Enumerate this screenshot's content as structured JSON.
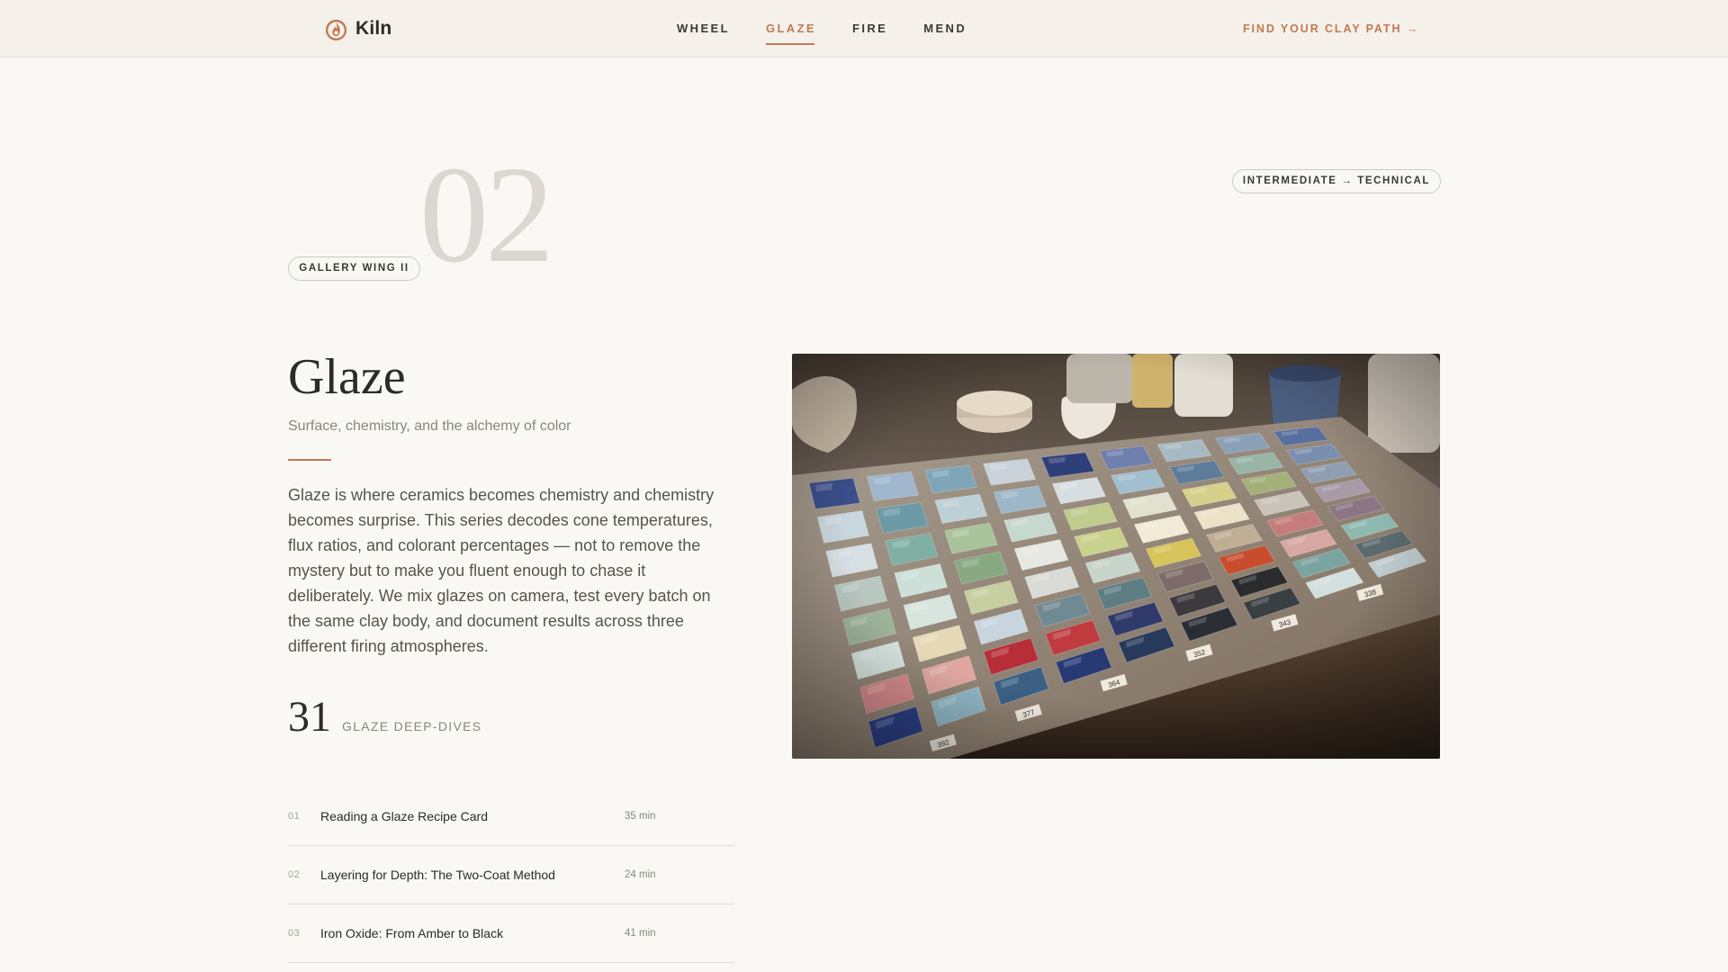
{
  "header": {
    "brand": "Kiln",
    "nav": [
      {
        "label": "WHEEL",
        "active": false
      },
      {
        "label": "GLAZE",
        "active": true
      },
      {
        "label": "FIRE",
        "active": false
      },
      {
        "label": "MEND",
        "active": false
      }
    ],
    "cta": "FIND YOUR CLAY PATH  →"
  },
  "hero": {
    "wing_label": "GALLERY WING II",
    "number": "02",
    "level_label": "INTERMEDIATE → TECHNICAL"
  },
  "section": {
    "title": "Glaze",
    "subtitle": "Surface, chemistry, and the alchemy of color",
    "body": "Glaze is where ceramics becomes chemistry and chemistry becomes surprise. This series decodes cone temperatures, flux ratios, and colorant percentages — not to remove the mystery but to make you fluent enough to chase it deliberately. We mix glazes on camera, test every batch on the same clay body, and document results across three different firing atmospheres.",
    "count": "31",
    "count_label": "GLAZE DEEP-DIVES"
  },
  "lessons": [
    {
      "num": "01",
      "title": "Reading a Glaze Recipe Card",
      "duration": "35 min"
    },
    {
      "num": "02",
      "title": "Layering for Depth: The Two-Coat Method",
      "duration": "24 min"
    },
    {
      "num": "03",
      "title": "Iron Oxide: From Amber to Black",
      "duration": "41 min"
    }
  ],
  "photo": {
    "tile_labels": [
      "392",
      "377",
      "364",
      "352",
      "343",
      "338"
    ]
  },
  "colors": {
    "accent": "#c07a52",
    "background": "#f9f8f4",
    "header_bg": "#f5f0ea",
    "ink": "#2e2a26",
    "muted": "#8c857c",
    "ghost_number": "#dcd8d1"
  }
}
